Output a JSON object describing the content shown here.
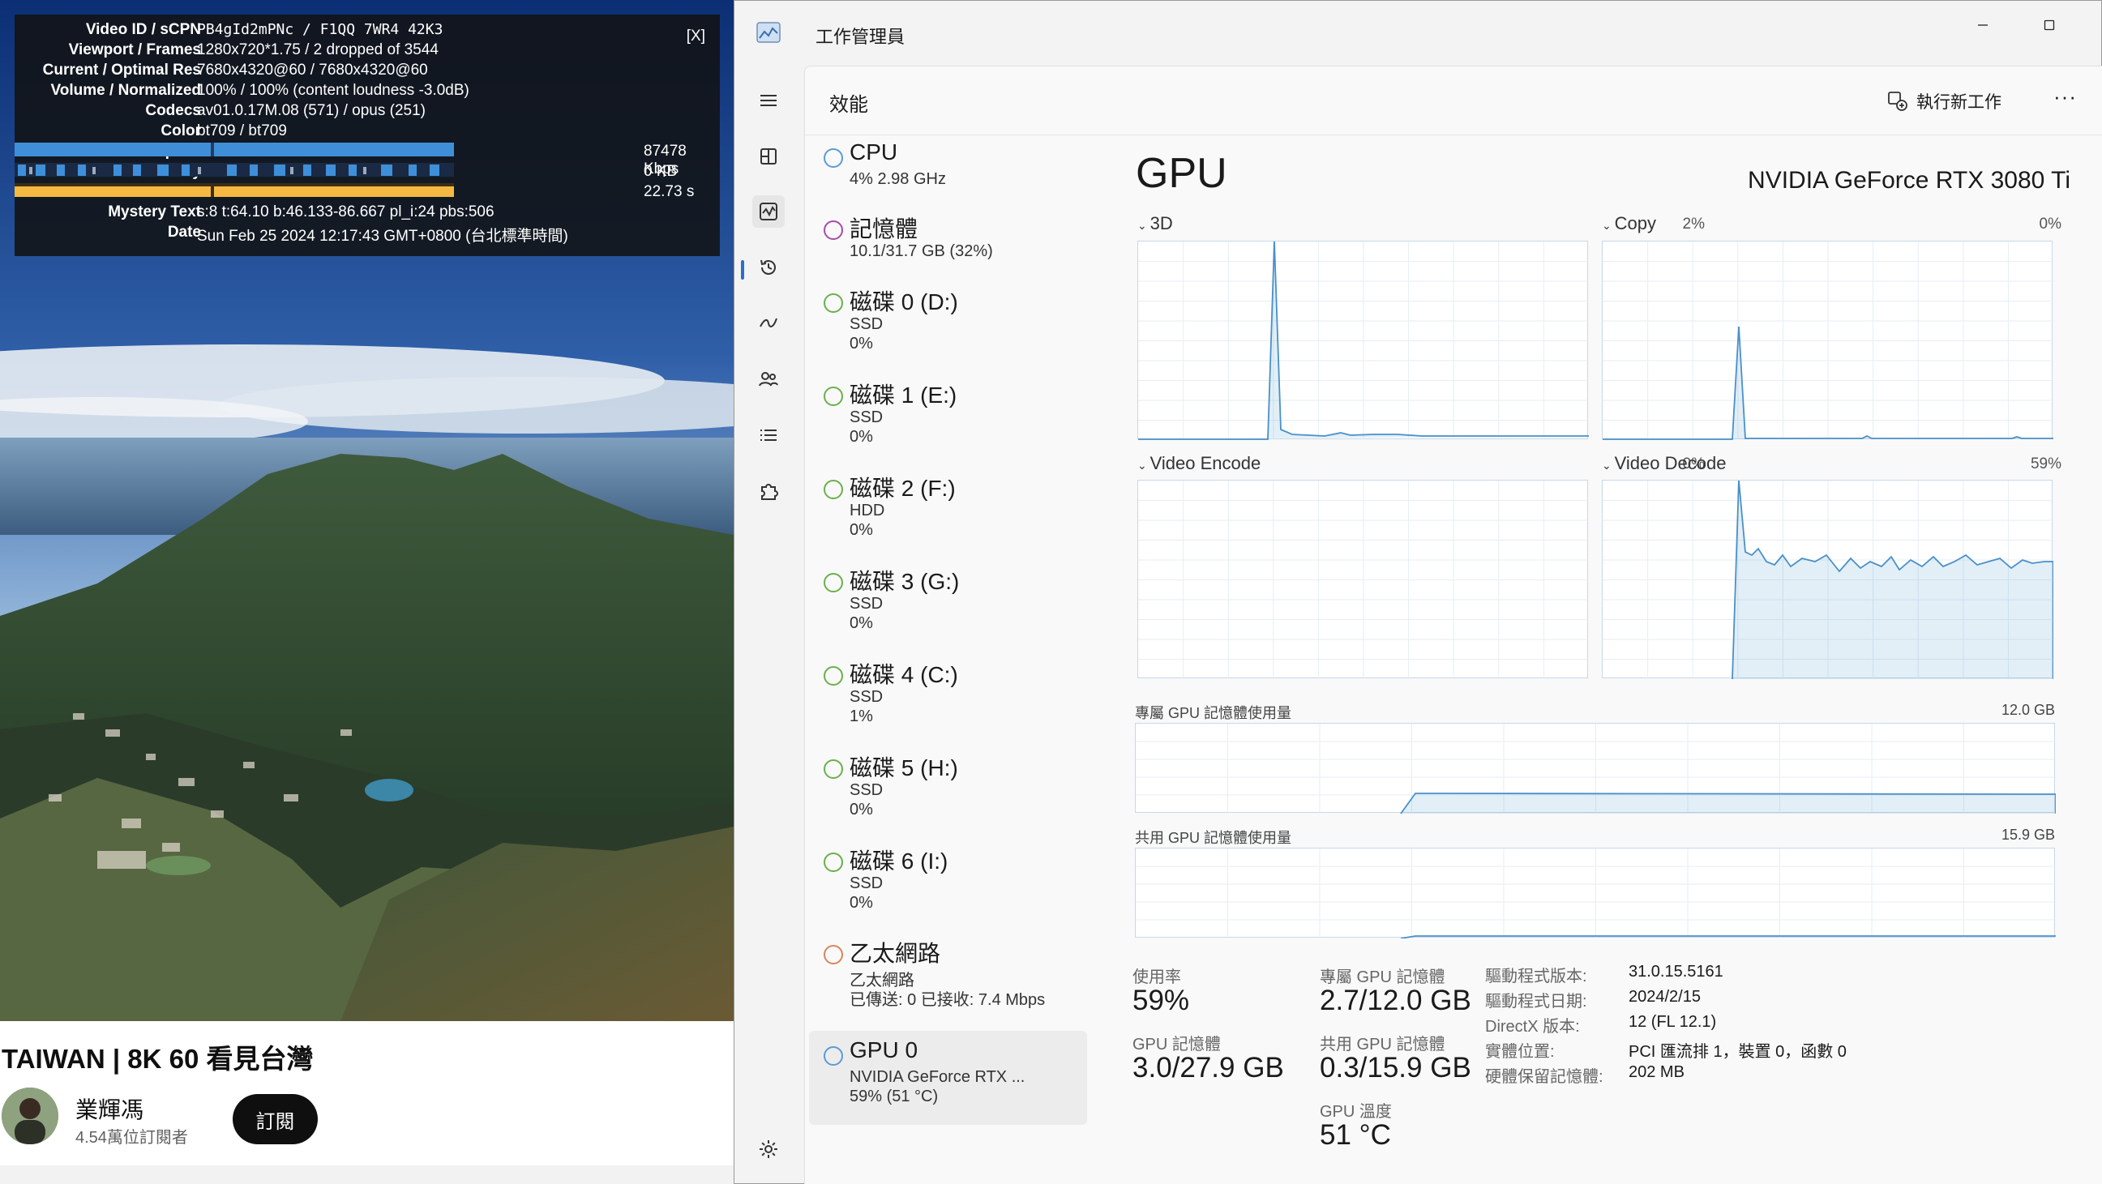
{
  "stats_overlay": {
    "close_label": "[X]",
    "rows": [
      {
        "label": "Video ID / sCPN",
        "value": "PB4gId2mPNc / F1QQ 7WR4 42K3"
      },
      {
        "label": "Viewport / Frames",
        "value": "1280x720*1.75 / 2 dropped of 3544"
      },
      {
        "label": "Current / Optimal Res",
        "value": "7680x4320@60 / 7680x4320@60"
      },
      {
        "label": "Volume / Normalized",
        "value": "100% / 100% (content loudness -3.0dB)"
      },
      {
        "label": "Codecs",
        "value": "av01.0.17M.08 (571) / opus (251)"
      },
      {
        "label": "Color",
        "value": "bt709 / bt709"
      },
      {
        "label": "Connection Speed",
        "value": "87478 Kbps"
      },
      {
        "label": "Network Activity",
        "value": "0 KB"
      },
      {
        "label": "Buffer Health",
        "value": "22.73 s"
      },
      {
        "label": "Mystery Text",
        "value": "s:8 t:64.10 b:46.133-86.667 pl_i:24 pbs:506"
      },
      {
        "label": "Date",
        "value": "Sun Feb 25 2024 12:17:43 GMT+0800 (台北標準時間)"
      }
    ]
  },
  "video": {
    "title": "TAIWAN | 8K 60 看見台灣",
    "channel": "業輝馮",
    "subscribers": "4.54萬位訂閱者",
    "subscribe_label": "訂閱"
  },
  "taskmgr": {
    "app_title": "工作管理員",
    "page_title": "效能",
    "run_task_label": "執行新工作",
    "more_label": "···",
    "resources": [
      {
        "name": "CPU",
        "sub1": "4% 2.98 GHz",
        "sub2": "",
        "color": "#5b9bd5"
      },
      {
        "name": "記憶體",
        "sub1": "10.1/31.7 GB (32%)",
        "sub2": "",
        "color": "#a64ca6"
      },
      {
        "name": "磁碟 0 (D:)",
        "sub1": "SSD",
        "sub2": "0%",
        "color": "#6ab04c"
      },
      {
        "name": "磁碟 1 (E:)",
        "sub1": "SSD",
        "sub2": "0%",
        "color": "#6ab04c"
      },
      {
        "name": "磁碟 2 (F:)",
        "sub1": "HDD",
        "sub2": "0%",
        "color": "#6ab04c"
      },
      {
        "name": "磁碟 3 (G:)",
        "sub1": "SSD",
        "sub2": "0%",
        "color": "#6ab04c"
      },
      {
        "name": "磁碟 4 (C:)",
        "sub1": "SSD",
        "sub2": "1%",
        "color": "#6ab04c"
      },
      {
        "name": "磁碟 5 (H:)",
        "sub1": "SSD",
        "sub2": "0%",
        "color": "#6ab04c"
      },
      {
        "name": "磁碟 6 (I:)",
        "sub1": "SSD",
        "sub2": "0%",
        "color": "#6ab04c"
      },
      {
        "name": "乙太網路",
        "sub1": "乙太網路",
        "sub2": "已傳送: 0 已接收: 7.4 Mbps",
        "color": "#d9855a"
      },
      {
        "name": "GPU 0",
        "sub1": "NVIDIA GeForce RTX ...",
        "sub2": "59% (51 °C)",
        "color": "#5b9bd5"
      }
    ],
    "gpu": {
      "title": "GPU",
      "model": "NVIDIA GeForce RTX 3080 Ti",
      "engines": [
        {
          "label": "3D",
          "pct": "2%"
        },
        {
          "label": "Copy",
          "pct": "0%"
        },
        {
          "label": "Video Encode",
          "pct": "0%"
        },
        {
          "label": "Video Decode",
          "pct": "59%"
        }
      ],
      "dedicated_label": "專屬 GPU 記憶體使用量",
      "dedicated_max": "12.0 GB",
      "shared_label": "共用 GPU 記憶體使用量",
      "shared_max": "15.9 GB",
      "stats": {
        "util_label": "使用率",
        "util_value": "59%",
        "gpu_mem_label": "GPU 記憶體",
        "gpu_mem_value": "3.0/27.9 GB",
        "ded_label": "專屬 GPU 記憶體",
        "ded_value": "2.7/12.0 GB",
        "shared_label": "共用 GPU 記憶體",
        "shared_value": "0.3/15.9 GB",
        "temp_label": "GPU 溫度",
        "temp_value": "51 °C"
      },
      "info": [
        {
          "k": "驅動程式版本:",
          "v": "31.0.15.5161"
        },
        {
          "k": "驅動程式日期:",
          "v": "2024/2/15"
        },
        {
          "k": "DirectX 版本:",
          "v": "12 (FL 12.1)"
        },
        {
          "k": "實體位置:",
          "v": "PCI 匯流排 1，裝置 0，函數 0"
        },
        {
          "k": "硬體保留記憶體:",
          "v": "202 MB"
        }
      ]
    }
  }
}
